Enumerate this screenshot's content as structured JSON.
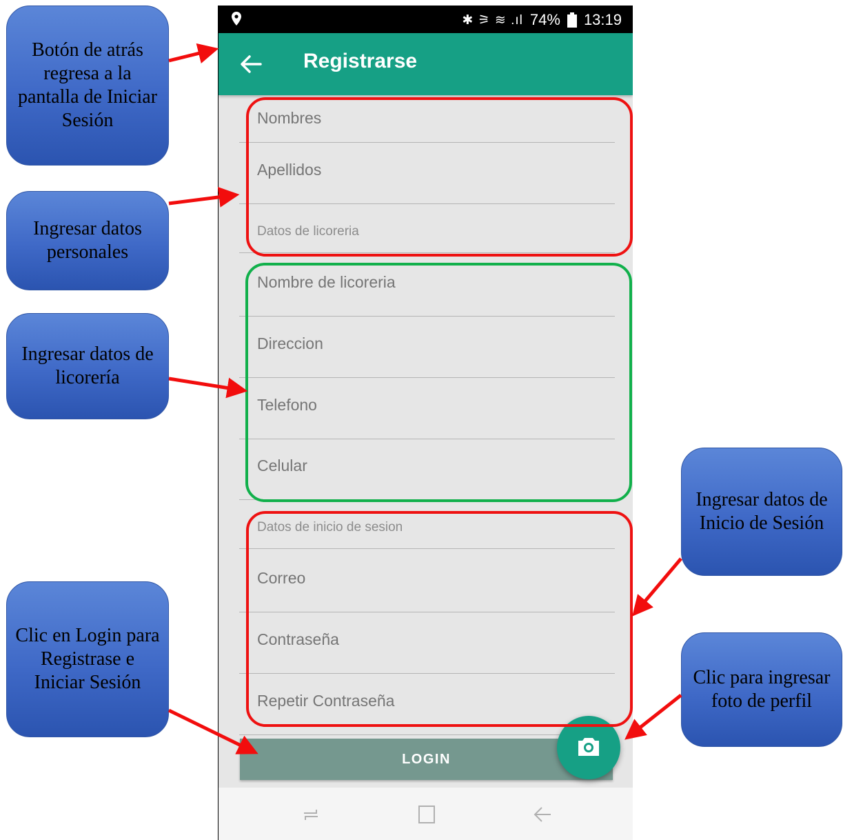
{
  "statusbar": {
    "battery": "74%",
    "time": "13:19",
    "signal": "✱ ⚞ ≋ .ıl"
  },
  "appbar": {
    "title": "Registrarse"
  },
  "form": {
    "personal": [
      "Nombres",
      "Apellidos"
    ],
    "section_liquor": "Datos de licoreria",
    "liquor": [
      "Nombre de licoreria",
      "Direccion",
      "Telefono",
      "Celular"
    ],
    "section_login": "Datos de inicio de sesion",
    "login": [
      "Correo",
      "Contraseña",
      "Repetir Contraseña"
    ],
    "login_button": "LOGIN"
  },
  "callouts": {
    "back": "Botón de atrás regresa a la pantalla de Iniciar Sesión",
    "personal": "Ingresar datos personales",
    "liquor": "Ingresar datos de licorería",
    "session": "Ingresar datos de Inicio de Sesión",
    "login": "Clic en Login para Registrase e Iniciar Sesión",
    "photo": "Clic para ingresar foto de perfil"
  },
  "colors": {
    "primary": "#16a085",
    "login_button": "#75988f",
    "highlight_red": "#ee1111",
    "highlight_green": "#11b04b",
    "callout_blue": "#3f69c7"
  }
}
